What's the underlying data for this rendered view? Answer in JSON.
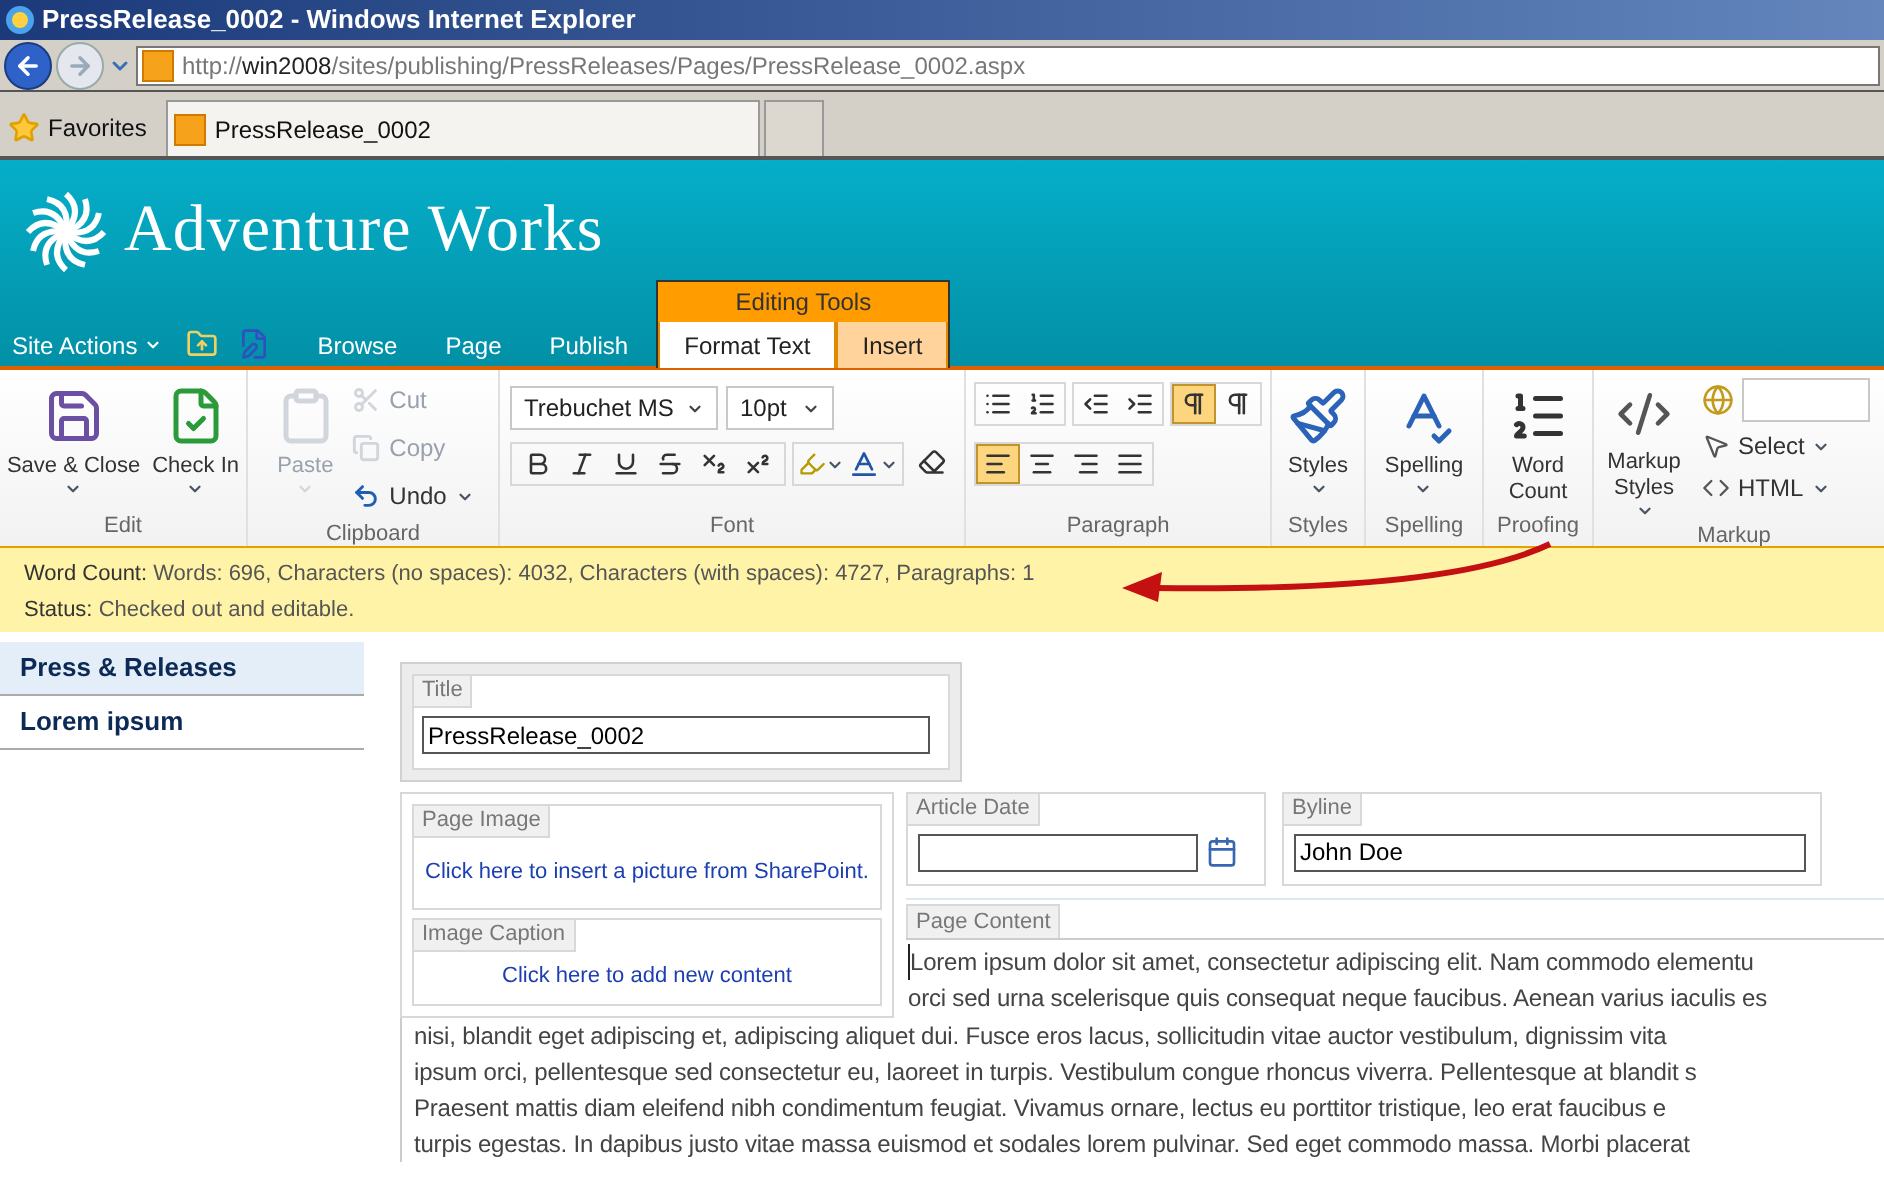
{
  "window": {
    "title": "PressRelease_0002 - Windows Internet Explorer"
  },
  "address_bar": {
    "scheme": "http://",
    "host": "win2008",
    "path": "/sites/publishing/PressReleases/Pages/PressRelease_0002.aspx"
  },
  "favorites": {
    "label": "Favorites"
  },
  "browser_tabs": [
    {
      "label": "PressRelease_0002",
      "selected": true
    }
  ],
  "site": {
    "name": "Adventure Works"
  },
  "site_actions": {
    "label": "Site Actions"
  },
  "contextual_group": {
    "label": "Editing Tools"
  },
  "ribbon_tabs": [
    {
      "label": "Browse",
      "selected": false,
      "contextual": false
    },
    {
      "label": "Page",
      "selected": false,
      "contextual": false
    },
    {
      "label": "Publish",
      "selected": false,
      "contextual": false
    },
    {
      "label": "Format Text",
      "selected": true,
      "contextual": true
    },
    {
      "label": "Insert",
      "selected": false,
      "contextual": true
    }
  ],
  "ribbon_groups": [
    {
      "kind": "edit",
      "label": "Edit",
      "buttons": [
        {
          "label": "Save & Close"
        },
        {
          "label": "Check In"
        }
      ]
    },
    {
      "kind": "clipboard",
      "label": "Clipboard",
      "paste": {
        "label": "Paste",
        "disabled": true
      },
      "buttons": [
        {
          "label": "Cut",
          "disabled": true
        },
        {
          "label": "Copy",
          "disabled": true
        },
        {
          "label": "Undo",
          "disabled": false
        }
      ]
    },
    {
      "kind": "font",
      "label": "Font",
      "font_name": "Trebuchet MS",
      "font_size": "10pt"
    },
    {
      "kind": "paragraph",
      "label": "Paragraph",
      "direction": [
        {
          "selected": true
        },
        {
          "selected": false
        }
      ],
      "alignment": [
        {
          "selected": true
        },
        {
          "selected": false
        },
        {
          "selected": false
        },
        {
          "selected": false
        }
      ]
    },
    {
      "kind": "styles",
      "label": "Styles",
      "button": "Styles"
    },
    {
      "kind": "spelling",
      "label": "Spelling",
      "button": "Spelling"
    },
    {
      "kind": "proofing",
      "label": "Proofing",
      "button": "Word Count"
    },
    {
      "kind": "markup",
      "label": "Markup",
      "styles_button": "Markup Styles",
      "select": "Select",
      "html": "HTML"
    }
  ],
  "status_bar": {
    "word_count": {
      "label": "Word Count:",
      "value": "Words: 696, Characters (no spaces): 4032, Characters (with spaces): 4727, Paragraphs: 1"
    },
    "status": {
      "label": "Status:",
      "value": "Checked out and editable."
    }
  },
  "nav": [
    {
      "label": "Press & Releases",
      "selected": true
    },
    {
      "label": "Lorem ipsum",
      "selected": false
    }
  ],
  "form": {
    "title": {
      "label": "Title",
      "value": "PressRelease_0002"
    },
    "page_image": {
      "label": "Page Image",
      "link": "Click here to insert a picture from SharePoint."
    },
    "image_caption": {
      "label": "Image Caption",
      "link": "Click here to add new content"
    },
    "article_date": {
      "label": "Article Date"
    },
    "byline": {
      "label": "Byline",
      "value": "John Doe"
    },
    "page_content": {
      "label": "Page Content",
      "lines": [
        "Lorem ipsum dolor sit amet, consectetur adipiscing elit. Nam commodo elementu",
        "orci sed urna scelerisque quis consequat neque faucibus. Aenean varius iaculis es",
        "nisi, blandit eget adipiscing et, adipiscing aliquet dui. Fusce eros lacus, sollicitudin vitae auctor vestibulum, dignissim vita",
        "ipsum orci, pellentesque sed consectetur eu, laoreet in turpis. Vestibulum congue rhoncus viverra. Pellentesque at blandit s",
        "Praesent mattis diam eleifend nibh condimentum feugiat. Vivamus ornare, lectus eu porttitor tristique, leo erat faucibus e",
        "turpis egestas. In dapibus justo vitae massa euismod et sodales lorem pulvinar. Sed eget commodo massa. Morbi placerat"
      ]
    }
  }
}
